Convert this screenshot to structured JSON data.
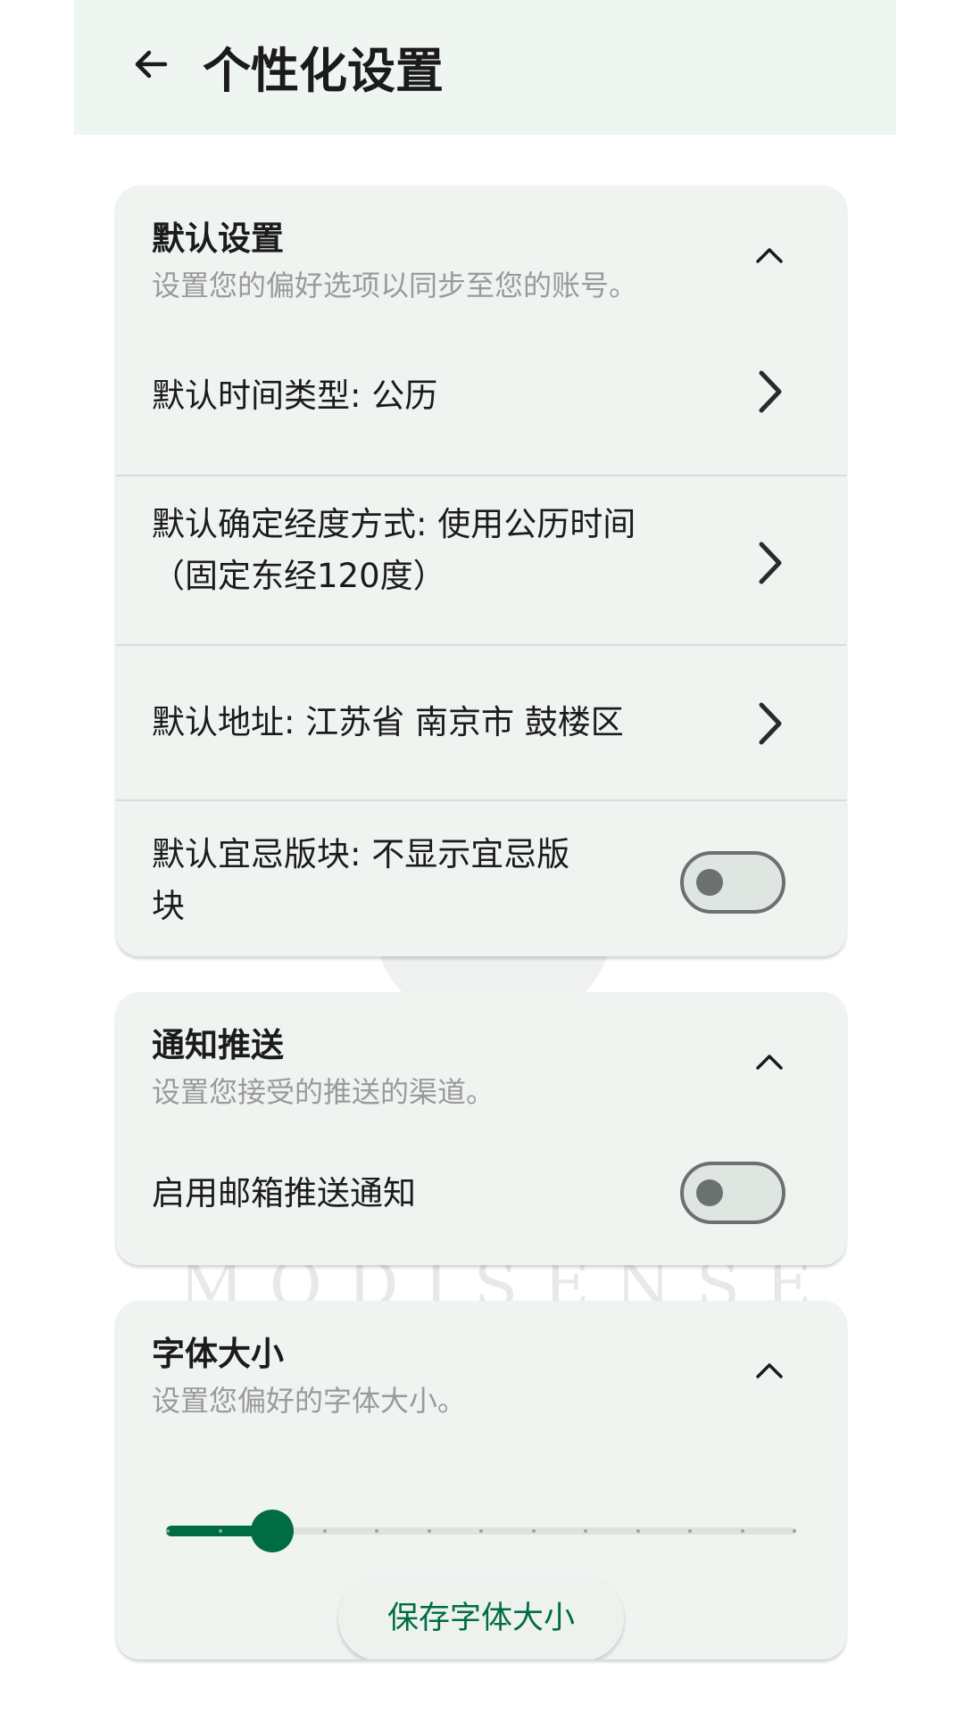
{
  "header": {
    "title": "个性化设置",
    "back_icon": "arrow-left-icon"
  },
  "watermark": "MODISENSE",
  "default_settings": {
    "title": "默认设置",
    "subtitle": "设置您的偏好选项以同步至您的账号。",
    "items": [
      {
        "label": "默认时间类型: 公历"
      },
      {
        "label": "默认确定经度方式: 使用公历时间",
        "label_line2": "（固定东经120度）"
      },
      {
        "label": "默认地址: 江苏省 南京市 鼓楼区"
      }
    ],
    "toggle_item": {
      "label": "默认宜忌版块: 不显示宜忌版",
      "label_line2": "块",
      "enabled": false
    }
  },
  "notifications": {
    "title": "通知推送",
    "subtitle": "设置您接受的推送的渠道。",
    "toggle_item": {
      "label": "启用邮箱推送通知",
      "enabled": false
    }
  },
  "font_size": {
    "title": "字体大小",
    "subtitle": "设置您偏好的字体大小。",
    "slider": {
      "steps": 13,
      "selected_index": 2
    },
    "save_label": "保存字体大小"
  },
  "colors": {
    "accent": "#006c45",
    "header_bg": "#eff5f1",
    "card_bg": "#f0f4f1",
    "text_primary": "#1b1b1b",
    "text_secondary": "#9a9a9a",
    "toggle_off": "#6b716e"
  }
}
